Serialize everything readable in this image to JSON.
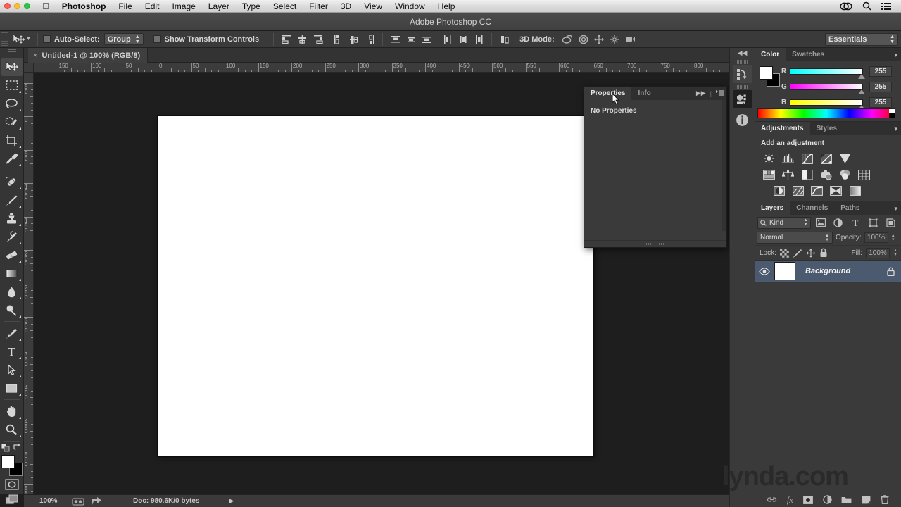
{
  "os_menubar": {
    "apple_icon": "apple-icon",
    "items": [
      {
        "label": "Photoshop",
        "bold": true
      },
      {
        "label": "File",
        "bold": false
      },
      {
        "label": "Edit",
        "bold": false
      },
      {
        "label": "Image",
        "bold": false
      },
      {
        "label": "Layer",
        "bold": false
      },
      {
        "label": "Type",
        "bold": false
      },
      {
        "label": "Select",
        "bold": false
      },
      {
        "label": "Filter",
        "bold": false
      },
      {
        "label": "3D",
        "bold": false
      },
      {
        "label": "View",
        "bold": false
      },
      {
        "label": "Window",
        "bold": false
      },
      {
        "label": "Help",
        "bold": false
      }
    ],
    "status_icons": [
      "creative-cloud-icon",
      "spotlight-search-icon",
      "notification-center-icon"
    ]
  },
  "app": {
    "title": "Adobe Photoshop CC"
  },
  "options_bar": {
    "tool_icon": "move-tool-icon",
    "auto_select_label": "Auto-Select:",
    "auto_select_checked": false,
    "auto_select_value": "Group",
    "show_transform_label": "Show Transform Controls",
    "show_transform_checked": false,
    "align_icons": [
      "align-left-edges-icon",
      "align-horizontal-centers-icon",
      "align-right-edges-icon",
      "align-top-edges-icon",
      "align-vertical-centers-icon",
      "align-bottom-edges-icon"
    ],
    "distribute_icons": [
      "distribute-top-edges-icon",
      "distribute-vertical-centers-icon",
      "distribute-bottom-edges-icon",
      "distribute-left-edges-icon",
      "distribute-horizontal-centers-icon",
      "distribute-right-edges-icon"
    ],
    "auto_align_icon": "auto-align-layers-icon",
    "mode_3d_label": "3D Mode:",
    "mode_3d_icons": [
      "rotate-3d-object-icon",
      "roll-3d-object-icon",
      "drag-3d-object-icon",
      "slide-3d-object-icon",
      "scale-3d-object-icon"
    ],
    "workspace_value": "Essentials"
  },
  "toolbar": {
    "tools": [
      {
        "name": "move-tool",
        "selected": true,
        "has_flyout": false
      },
      {
        "name": "rectangular-marquee-tool",
        "selected": false,
        "has_flyout": true
      },
      {
        "name": "lasso-tool",
        "selected": false,
        "has_flyout": true
      },
      {
        "name": "quick-selection-tool",
        "selected": false,
        "has_flyout": true
      },
      {
        "name": "crop-tool",
        "selected": false,
        "has_flyout": true
      },
      {
        "name": "eyedropper-tool",
        "selected": false,
        "has_flyout": true
      },
      {
        "name": "spot-healing-brush-tool",
        "selected": false,
        "has_flyout": true
      },
      {
        "name": "brush-tool",
        "selected": false,
        "has_flyout": true
      },
      {
        "name": "clone-stamp-tool",
        "selected": false,
        "has_flyout": true
      },
      {
        "name": "history-brush-tool",
        "selected": false,
        "has_flyout": true
      },
      {
        "name": "eraser-tool",
        "selected": false,
        "has_flyout": true
      },
      {
        "name": "gradient-tool",
        "selected": false,
        "has_flyout": true
      },
      {
        "name": "blur-tool",
        "selected": false,
        "has_flyout": true
      },
      {
        "name": "dodge-tool",
        "selected": false,
        "has_flyout": true
      },
      {
        "name": "pen-tool",
        "selected": false,
        "has_flyout": true
      },
      {
        "name": "horizontal-type-tool",
        "selected": false,
        "has_flyout": true
      },
      {
        "name": "path-selection-tool",
        "selected": false,
        "has_flyout": true
      },
      {
        "name": "rectangle-tool",
        "selected": false,
        "has_flyout": true
      },
      {
        "name": "hand-tool",
        "selected": false,
        "has_flyout": true
      },
      {
        "name": "zoom-tool",
        "selected": false,
        "has_flyout": true
      }
    ],
    "foreground_color": "#ffffff",
    "background_color": "#000000",
    "quick_mask_icon": "quick-mask-mode-icon",
    "screen_mode_icon": "screen-mode-icon"
  },
  "document": {
    "tab_label": "Untitled-1 @ 100% (RGB/8)",
    "close_glyph": "×",
    "canvas_background": "#ffffff"
  },
  "rulers": {
    "horizontal_ticks": [
      "150",
      "100",
      "50",
      "0",
      "50",
      "100",
      "150",
      "200",
      "250",
      "300",
      "350",
      "400",
      "450",
      "500",
      "550",
      "600",
      "650",
      "700",
      "750",
      "800"
    ],
    "vertical_ticks": [
      "50",
      "0",
      "50",
      "100",
      "150",
      "200",
      "250",
      "300",
      "350",
      "400",
      "450",
      "500",
      "550"
    ]
  },
  "status_bar": {
    "zoom": "100%",
    "doc_info": "Doc: 980.6K/0 bytes",
    "icons": [
      "camera-raw-icon",
      "share-icon"
    ],
    "play_glyph": "▶"
  },
  "properties_panel": {
    "tabs": [
      {
        "label": "Properties",
        "active": true
      },
      {
        "label": "Info",
        "active": false
      }
    ],
    "expand_glyph": "▶▶",
    "menu_glyph": "≡",
    "empty_message": "No Properties"
  },
  "dock_rail": {
    "collapse_glyph": "◀◀",
    "icons": [
      "history-panel-icon",
      "mini-bridge-icon",
      "info-panel-icon"
    ]
  },
  "color_panel": {
    "tabs": [
      {
        "label": "Color",
        "active": true
      },
      {
        "label": "Swatches",
        "active": false
      }
    ],
    "menu_glyph": "▾",
    "foreground_color": "#ffffff",
    "background_color": "#000000",
    "sliders": [
      {
        "label": "R",
        "value": "255"
      },
      {
        "label": "G",
        "value": "255"
      },
      {
        "label": "B",
        "value": "255"
      }
    ]
  },
  "adjustments_panel": {
    "tabs": [
      {
        "label": "Adjustments",
        "active": true
      },
      {
        "label": "Styles",
        "active": false
      }
    ],
    "menu_glyph": "▾",
    "heading": "Add an adjustment",
    "icons": [
      "brightness-contrast-icon",
      "levels-icon",
      "curves-icon",
      "exposure-icon",
      "vibrance-icon",
      "hue-saturation-icon",
      "color-balance-icon",
      "black-white-icon",
      "photo-filter-icon",
      "channel-mixer-icon",
      "color-lookup-icon",
      "invert-icon",
      "posterize-icon",
      "threshold-icon",
      "selective-color-icon",
      "gradient-map-icon"
    ]
  },
  "layers_panel": {
    "tabs": [
      {
        "label": "Layers",
        "active": true
      },
      {
        "label": "Channels",
        "active": false
      },
      {
        "label": "Paths",
        "active": false
      }
    ],
    "menu_glyph": "▾",
    "filter_label": "Kind",
    "filter_icon": "search-icon",
    "filter_buttons": [
      "filter-pixel-layers-icon",
      "filter-adjustment-layers-icon",
      "filter-type-layers-icon",
      "filter-shape-layers-icon",
      "filter-smart-objects-icon"
    ],
    "blend_mode": "Normal",
    "opacity_label": "Opacity:",
    "opacity_value": "100%",
    "lock_label": "Lock:",
    "lock_buttons": [
      "lock-transparent-pixels-icon",
      "lock-image-pixels-icon",
      "lock-position-icon",
      "lock-all-icon"
    ],
    "fill_label": "Fill:",
    "fill_value": "100%",
    "layers": [
      {
        "name": "Background",
        "visible": true,
        "locked": true,
        "selected": true,
        "thumb_color": "#ffffff"
      }
    ],
    "footer_icons": [
      "link-layers-icon",
      "layer-style-fx-icon",
      "add-layer-mask-icon",
      "new-adjustment-layer-icon",
      "new-group-icon",
      "new-layer-icon",
      "delete-layer-icon"
    ]
  },
  "watermark": {
    "text": "lynda.com"
  },
  "colors": {
    "panel_bg": "#3a3a3a",
    "panel_dark": "#2f2f2f",
    "canvas_bg": "#1e1e1e",
    "layer_selected": "#4b5a6e",
    "text": "#d2d2d2"
  }
}
